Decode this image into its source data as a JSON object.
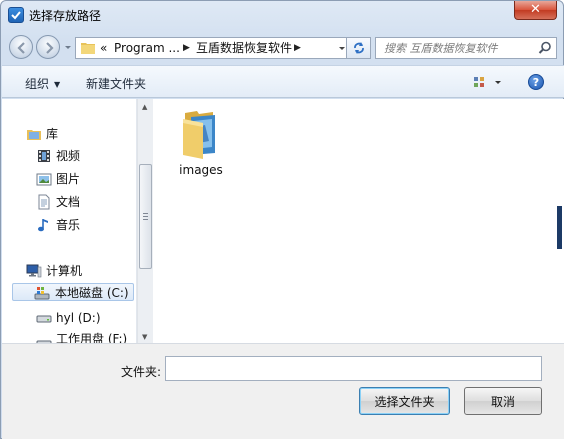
{
  "window": {
    "title": "选择存放路径",
    "close_glyph": "✕"
  },
  "address": {
    "crumbs": [
      "«",
      "Program ...",
      "互盾数据恢复软件"
    ],
    "search_placeholder": "搜索 互盾数据恢复软件"
  },
  "toolbar": {
    "organize": "组织",
    "new_folder": "新建文件夹",
    "help_glyph": "?"
  },
  "nav": {
    "libraries": "库",
    "videos": "视频",
    "pictures": "图片",
    "documents": "文档",
    "music": "音乐",
    "computer": "计算机",
    "drive_c": "本地磁盘 (C:)",
    "drive_d": "hyl (D:)",
    "drive_f": "工作用盘 (F:)"
  },
  "content": {
    "items": [
      {
        "name": "images",
        "type": "folder"
      }
    ]
  },
  "bottom": {
    "folder_label": "文件夹:",
    "folder_value": "",
    "select_button": "选择文件夹",
    "cancel_button": "取消"
  },
  "colors": {
    "accent": "#3c7fb1",
    "close": "#c23b22",
    "selection": "#dce9f8"
  }
}
